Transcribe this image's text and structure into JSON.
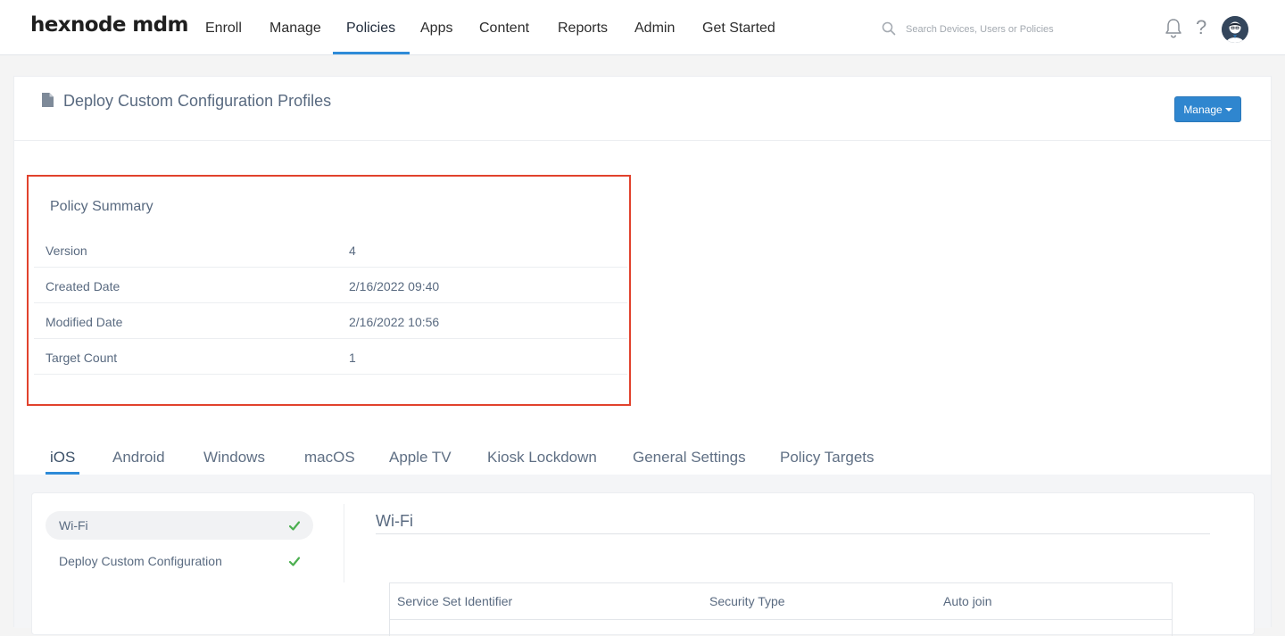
{
  "brand": {
    "logo_text": "hexnode mdm"
  },
  "nav": {
    "items": [
      {
        "label": "Enroll"
      },
      {
        "label": "Manage"
      },
      {
        "label": "Policies"
      },
      {
        "label": "Apps"
      },
      {
        "label": "Content"
      },
      {
        "label": "Reports"
      },
      {
        "label": "Admin"
      },
      {
        "label": "Get Started"
      }
    ],
    "active": "Policies"
  },
  "search": {
    "placeholder": "Search Devices, Users or Policies",
    "value": ""
  },
  "header_icons": [
    "search-icon",
    "bell-icon",
    "help-icon",
    "avatar"
  ],
  "page": {
    "title": "Deploy Custom Configuration Profiles",
    "manage_label": "Manage"
  },
  "summary": {
    "title": "Policy Summary",
    "rows": [
      {
        "label": "Version",
        "value": "4"
      },
      {
        "label": "Created Date",
        "value": "2/16/2022 09:40"
      },
      {
        "label": "Modified Date",
        "value": "2/16/2022 10:56"
      },
      {
        "label": "Target Count",
        "value": "1"
      }
    ]
  },
  "tabs": {
    "items": [
      {
        "label": "iOS"
      },
      {
        "label": "Android"
      },
      {
        "label": "Windows"
      },
      {
        "label": "macOS"
      },
      {
        "label": "Apple TV"
      },
      {
        "label": "Kiosk Lockdown"
      },
      {
        "label": "General Settings"
      },
      {
        "label": "Policy Targets"
      }
    ],
    "active": "iOS"
  },
  "sidebar": {
    "items": [
      {
        "label": "Wi-Fi",
        "configured": true
      },
      {
        "label": "Deploy Custom Configuration",
        "configured": true
      }
    ],
    "active": "Wi-Fi"
  },
  "section": {
    "title": "Wi-Fi",
    "table": {
      "columns": [
        "Service Set Identifier",
        "Security Type",
        "Auto join"
      ]
    }
  },
  "colors": {
    "accent": "#2e8bd8",
    "highlight_border": "#e1422d",
    "check_green": "#4caf50",
    "button": "#2f86cf"
  }
}
